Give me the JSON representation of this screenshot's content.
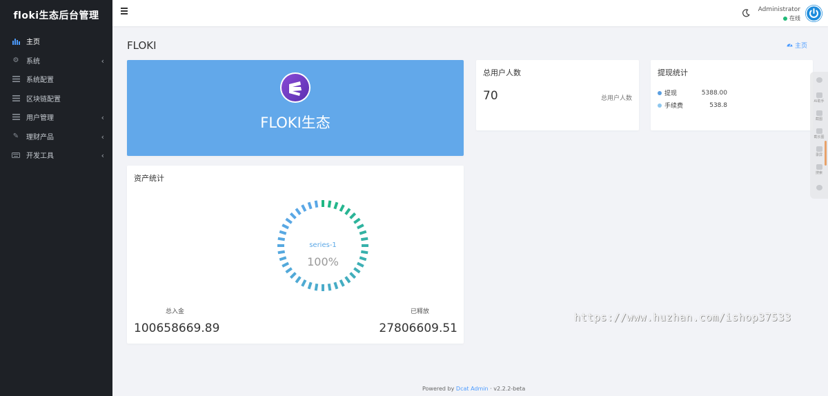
{
  "app": {
    "title": "floki生态后台管理"
  },
  "sidebar": {
    "items": [
      {
        "label": "主页",
        "icon": "bar-chart-icon"
      },
      {
        "label": "系统",
        "icon": "gear-icon"
      },
      {
        "label": "系统配置",
        "icon": "list-icon"
      },
      {
        "label": "区块链配置",
        "icon": "list-icon"
      },
      {
        "label": "用户管理",
        "icon": "list-icon"
      },
      {
        "label": "理财产品",
        "icon": "pencil-icon"
      },
      {
        "label": "开发工具",
        "icon": "keyboard-icon"
      }
    ]
  },
  "navbar": {
    "user_name": "Administrator",
    "user_status": "在线"
  },
  "page": {
    "title": "FLOKI",
    "breadcrumb": "主页"
  },
  "banner": {
    "title": "FLOKI生态"
  },
  "users": {
    "title": "总用户人数",
    "count": "70",
    "label": "总用户人数"
  },
  "withdraw": {
    "title": "提现统计",
    "items": [
      {
        "label": "提现",
        "value": "5388.00",
        "color": "#5b9fe0"
      },
      {
        "label": "手续费",
        "value": "538.8",
        "color": "#8ec7ee"
      }
    ]
  },
  "asset": {
    "title": "资产统计",
    "series_name": "series-1",
    "percent": "100%",
    "percent_value": 100,
    "total_in_label": "总入金",
    "total_in_value": "100658669.89",
    "released_label": "已释放",
    "released_value": "27806609.51",
    "gradient": [
      "#1fb783",
      "#5aa7e6"
    ]
  },
  "watermark": "https://www.huzhan.com/ishop37533",
  "floatbar": {
    "items": [
      "AI助手",
      "截图",
      "截长图",
      "录屏",
      "搜索"
    ]
  },
  "footer": {
    "prefix": "Powered by",
    "link": "Dcat Admin",
    "version": "v2.2.2-beta"
  },
  "colors": {
    "accent": "#4c9bff",
    "sidebar_bg": "#1e2126",
    "banner_bg": "#62a8ea",
    "online": "#21b978"
  }
}
